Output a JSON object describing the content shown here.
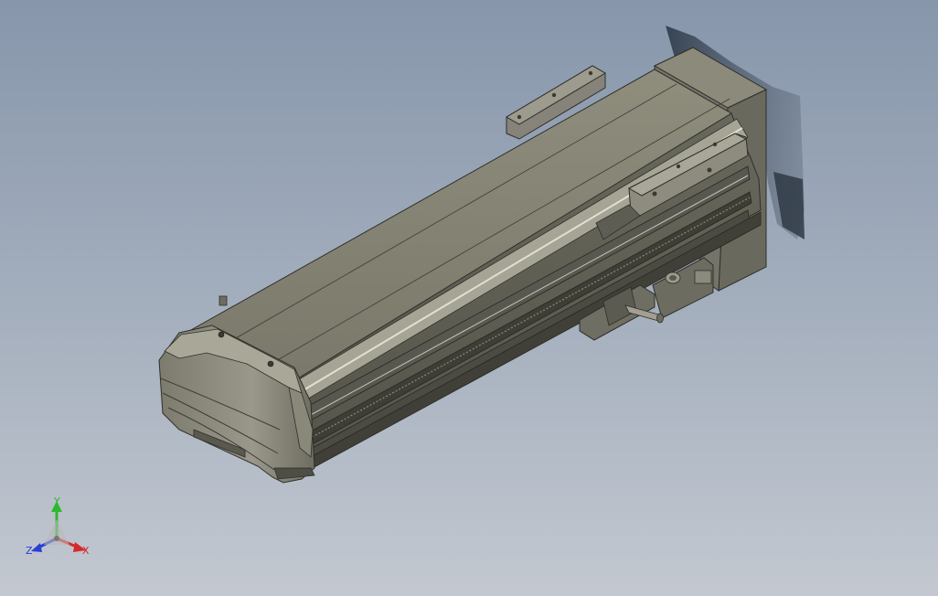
{
  "viewport": {
    "model": "linear-actuator-slide-module",
    "background_top": "#8796ab",
    "background_bottom": "#c3c8d0"
  },
  "triad": {
    "x_label": "X",
    "y_label": "Y",
    "z_label": "Z",
    "x_color": "#d42a2a",
    "y_color": "#2eb82e",
    "z_color": "#2a3fd4"
  }
}
